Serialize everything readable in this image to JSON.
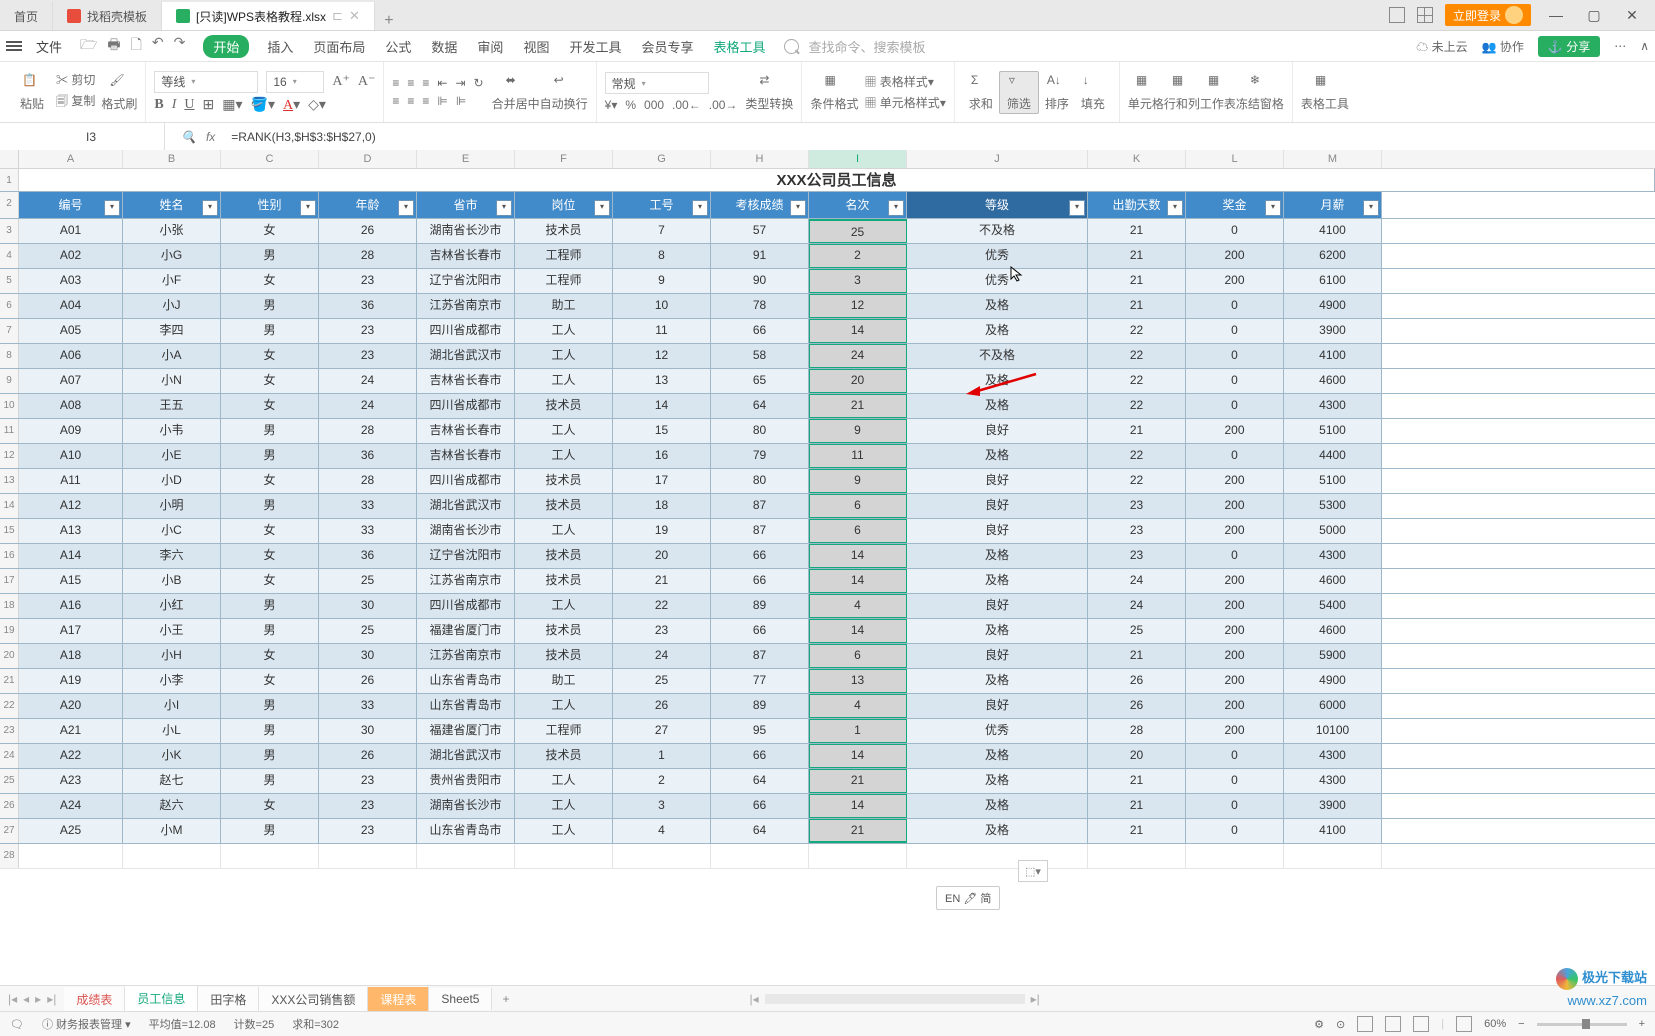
{
  "titlebar": {
    "tabs": [
      {
        "label": "首页"
      },
      {
        "label": "找稻壳模板"
      },
      {
        "label": "[只读]WPS表格教程.xlsx"
      }
    ],
    "login": "立即登录"
  },
  "menubar": {
    "file": "文件",
    "items": [
      "开始",
      "插入",
      "页面布局",
      "公式",
      "数据",
      "审阅",
      "视图",
      "开发工具",
      "会员专享",
      "表格工具"
    ],
    "search_placeholder": "查找命令、搜索模板",
    "cloud": "未上云",
    "coop": "协作",
    "share": "分享"
  },
  "ribbon": {
    "paste": "粘贴",
    "cut": "剪切",
    "copy": "复制",
    "format_painter": "格式刷",
    "font_name": "等线",
    "font_size": "16",
    "merge": "合并居中",
    "wrap": "自动换行",
    "numfmt": "常规",
    "type_convert": "类型转换",
    "cond_fmt": "条件格式",
    "table_style": "表格样式",
    "cell_style": "单元格样式",
    "sum": "求和",
    "filter": "筛选",
    "sort": "排序",
    "fill": "填充",
    "cells": "单元格",
    "rowcol": "行和列",
    "sheet": "工作表",
    "freeze": "冻结窗格",
    "tools": "表格工具"
  },
  "formula": {
    "name_box": "I3",
    "value": "=RANK(H3,$H$3:$H$27,0)"
  },
  "col_letters": [
    "A",
    "B",
    "C",
    "D",
    "E",
    "F",
    "G",
    "H",
    "I",
    "J",
    "K",
    "L",
    "M"
  ],
  "sheet": {
    "title": "XXX公司员工信息",
    "headers": [
      "编号",
      "姓名",
      "性别",
      "年龄",
      "省市",
      "岗位",
      "工号",
      "考核成绩",
      "名次",
      "等级",
      "出勤天数",
      "奖金",
      "月薪"
    ],
    "rows": [
      [
        "A01",
        "小张",
        "女",
        "26",
        "湖南省长沙市",
        "技术员",
        "7",
        "57",
        "25",
        "不及格",
        "21",
        "0",
        "4100"
      ],
      [
        "A02",
        "小G",
        "男",
        "28",
        "吉林省长春市",
        "工程师",
        "8",
        "91",
        "2",
        "优秀",
        "21",
        "200",
        "6200"
      ],
      [
        "A03",
        "小F",
        "女",
        "23",
        "辽宁省沈阳市",
        "工程师",
        "9",
        "90",
        "3",
        "优秀",
        "21",
        "200",
        "6100"
      ],
      [
        "A04",
        "小J",
        "男",
        "36",
        "江苏省南京市",
        "助工",
        "10",
        "78",
        "12",
        "及格",
        "21",
        "0",
        "4900"
      ],
      [
        "A05",
        "李四",
        "男",
        "23",
        "四川省成都市",
        "工人",
        "11",
        "66",
        "14",
        "及格",
        "22",
        "0",
        "3900"
      ],
      [
        "A06",
        "小A",
        "女",
        "23",
        "湖北省武汉市",
        "工人",
        "12",
        "58",
        "24",
        "不及格",
        "22",
        "0",
        "4100"
      ],
      [
        "A07",
        "小N",
        "女",
        "24",
        "吉林省长春市",
        "工人",
        "13",
        "65",
        "20",
        "及格",
        "22",
        "0",
        "4600"
      ],
      [
        "A08",
        "王五",
        "女",
        "24",
        "四川省成都市",
        "技术员",
        "14",
        "64",
        "21",
        "及格",
        "22",
        "0",
        "4300"
      ],
      [
        "A09",
        "小韦",
        "男",
        "28",
        "吉林省长春市",
        "工人",
        "15",
        "80",
        "9",
        "良好",
        "21",
        "200",
        "5100"
      ],
      [
        "A10",
        "小E",
        "男",
        "36",
        "吉林省长春市",
        "工人",
        "16",
        "79",
        "11",
        "及格",
        "22",
        "0",
        "4400"
      ],
      [
        "A11",
        "小D",
        "女",
        "28",
        "四川省成都市",
        "技术员",
        "17",
        "80",
        "9",
        "良好",
        "22",
        "200",
        "5100"
      ],
      [
        "A12",
        "小明",
        "男",
        "33",
        "湖北省武汉市",
        "技术员",
        "18",
        "87",
        "6",
        "良好",
        "23",
        "200",
        "5300"
      ],
      [
        "A13",
        "小C",
        "女",
        "33",
        "湖南省长沙市",
        "工人",
        "19",
        "87",
        "6",
        "良好",
        "23",
        "200",
        "5000"
      ],
      [
        "A14",
        "李六",
        "女",
        "36",
        "辽宁省沈阳市",
        "技术员",
        "20",
        "66",
        "14",
        "及格",
        "23",
        "0",
        "4300"
      ],
      [
        "A15",
        "小B",
        "女",
        "25",
        "江苏省南京市",
        "技术员",
        "21",
        "66",
        "14",
        "及格",
        "24",
        "200",
        "4600"
      ],
      [
        "A16",
        "小红",
        "男",
        "30",
        "四川省成都市",
        "工人",
        "22",
        "89",
        "4",
        "良好",
        "24",
        "200",
        "5400"
      ],
      [
        "A17",
        "小王",
        "男",
        "25",
        "福建省厦门市",
        "技术员",
        "23",
        "66",
        "14",
        "及格",
        "25",
        "200",
        "4600"
      ],
      [
        "A18",
        "小H",
        "女",
        "30",
        "江苏省南京市",
        "技术员",
        "24",
        "87",
        "6",
        "良好",
        "21",
        "200",
        "5900"
      ],
      [
        "A19",
        "小李",
        "女",
        "26",
        "山东省青岛市",
        "助工",
        "25",
        "77",
        "13",
        "及格",
        "26",
        "200",
        "4900"
      ],
      [
        "A20",
        "小I",
        "男",
        "33",
        "山东省青岛市",
        "工人",
        "26",
        "89",
        "4",
        "良好",
        "26",
        "200",
        "6000"
      ],
      [
        "A21",
        "小L",
        "男",
        "30",
        "福建省厦门市",
        "工程师",
        "27",
        "95",
        "1",
        "优秀",
        "28",
        "200",
        "10100"
      ],
      [
        "A22",
        "小K",
        "男",
        "26",
        "湖北省武汉市",
        "技术员",
        "1",
        "66",
        "14",
        "及格",
        "20",
        "0",
        "4300"
      ],
      [
        "A23",
        "赵七",
        "男",
        "23",
        "贵州省贵阳市",
        "工人",
        "2",
        "64",
        "21",
        "及格",
        "21",
        "0",
        "4300"
      ],
      [
        "A24",
        "赵六",
        "女",
        "23",
        "湖南省长沙市",
        "工人",
        "3",
        "66",
        "14",
        "及格",
        "21",
        "0",
        "3900"
      ],
      [
        "A25",
        "小M",
        "男",
        "23",
        "山东省青岛市",
        "工人",
        "4",
        "64",
        "21",
        "及格",
        "21",
        "0",
        "4100"
      ]
    ]
  },
  "sheet_tabs": [
    "成绩表",
    "员工信息",
    "田字格",
    "XXX公司销售额",
    "课程表",
    "Sheet5"
  ],
  "ime": "EN 🖊 简",
  "status": {
    "workbook": "财务报表管理",
    "avg": "平均值=12.08",
    "count": "计数=25",
    "sum": "求和=302",
    "zoom": "60%"
  },
  "watermark": {
    "brand": "极光下载站",
    "site": "www.xz7.com"
  }
}
